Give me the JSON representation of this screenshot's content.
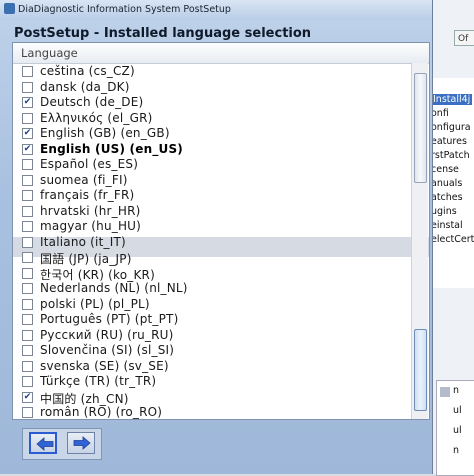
{
  "window": {
    "title": "DiaDiagnostic Information System PostSetup",
    "heading": "PostSetup - Installed language selection"
  },
  "list": {
    "column_header": "Language",
    "items": [
      {
        "label": "ceština (cs_CZ)",
        "checked": false,
        "bold": false
      },
      {
        "label": "dansk (da_DK)",
        "checked": false,
        "bold": false
      },
      {
        "label": "Deutsch (de_DE)",
        "checked": true,
        "bold": false
      },
      {
        "label": "Ελληνικός (el_GR)",
        "checked": false,
        "bold": false
      },
      {
        "label": "English (GB) (en_GB)",
        "checked": true,
        "bold": false
      },
      {
        "label": "English (US) (en_US)",
        "checked": true,
        "bold": true
      },
      {
        "label": "Español (es_ES)",
        "checked": false,
        "bold": false
      },
      {
        "label": "suomea (fi_FI)",
        "checked": false,
        "bold": false
      },
      {
        "label": "français (fr_FR)",
        "checked": false,
        "bold": false
      },
      {
        "label": "hrvatski (hr_HR)",
        "checked": false,
        "bold": false
      },
      {
        "label": "magyar (hu_HU)",
        "checked": false,
        "bold": false
      },
      {
        "label": "Italiano (it_IT)",
        "checked": false,
        "bold": false
      },
      {
        "label": "国語 (JP) (ja_JP)",
        "checked": false,
        "bold": false
      },
      {
        "label": "한국어 (KR) (ko_KR)",
        "checked": false,
        "bold": false
      },
      {
        "label": "Nederlands (NL) (nl_NL)",
        "checked": false,
        "bold": false
      },
      {
        "label": "polski (PL) (pl_PL)",
        "checked": false,
        "bold": false
      },
      {
        "label": "Português (PT) (pt_PT)",
        "checked": false,
        "bold": false
      },
      {
        "label": "Русский (RU) (ru_RU)",
        "checked": false,
        "bold": false
      },
      {
        "label": "Slovenčina (SI) (sl_SI)",
        "checked": false,
        "bold": false
      },
      {
        "label": "svenska (SE) (sv_SE)",
        "checked": false,
        "bold": false
      },
      {
        "label": "Türkçe (TR) (tr_TR)",
        "checked": false,
        "bold": false
      },
      {
        "label": "中国的 (zh_CN)",
        "checked": true,
        "bold": false
      },
      {
        "label": "român (RO) (ro_RO)",
        "checked": false,
        "bold": false
      }
    ]
  },
  "background_app": {
    "top_button": "Of",
    "items": [
      "Install4j",
      "onfi",
      "onfigura",
      "eatures",
      "rstPatch",
      "cense",
      "anuals",
      "atches",
      "ugins",
      "einstal",
      "electCertifi"
    ],
    "selected_index": 0,
    "lower_items": [
      "n",
      "ul",
      "ul",
      "n"
    ]
  },
  "colors": {
    "accent": "#2a5bd0",
    "window_bg": "#a9c1e0"
  },
  "icons": {
    "back": "arrow-left-icon",
    "next": "arrow-right-icon"
  }
}
